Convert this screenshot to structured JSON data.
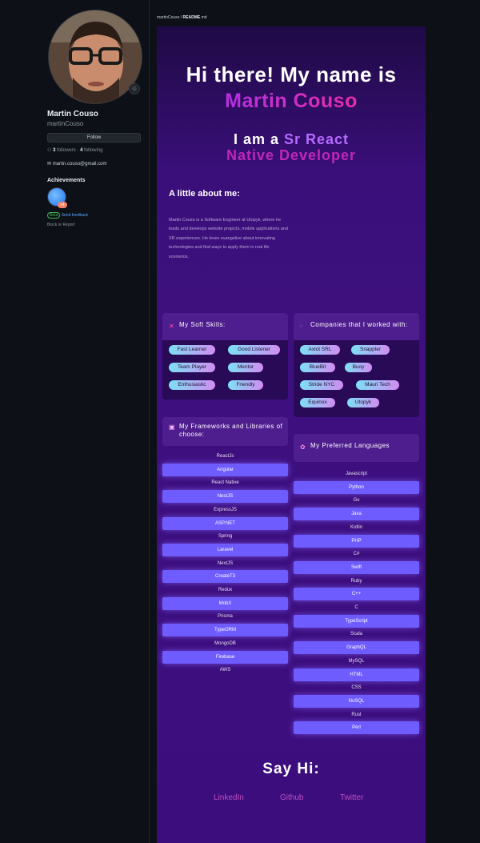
{
  "profile": {
    "name": "Martin Couso",
    "login": "martinCouso",
    "follow_label": "Follow",
    "followers_count": "3",
    "followers_label": "followers",
    "following_count": "4",
    "following_label": "following",
    "email": "martin.couso@gmail.com",
    "achievements_title": "Achievements",
    "achievement_count": "x4",
    "beta_tag": "Beta",
    "beta_link": "Send feedback",
    "block_report": "Block or Report"
  },
  "breadcrumb": {
    "repo": "martinCouso",
    "sep": "/",
    "file": "README",
    "ext": ".md"
  },
  "readme": {
    "hi": "Hi there! My name is",
    "name": "Martin Couso",
    "iam_prefix": "I am a",
    "iam_highlight": "Sr React",
    "role_line2": "Native Developer",
    "about_title": "A little about me:",
    "about_text": "Martin Couso is a Software Engineer at Utopyk, where he leads and develops website projects, mobile applications and XR experiences. He loves evangelize about innovating technologies and find ways to apply them in real life scenarios.",
    "soft_skills_title": "My Soft Skills:",
    "soft_skills": [
      "Fast Learner",
      "Good Listener",
      "Team Player",
      "Mentor",
      "Enthusiastic",
      "Friendly"
    ],
    "companies_title": "Companies that I worked with:",
    "companies": [
      "Axlot SRL",
      "Snappler",
      "BlueBit",
      "Buoy",
      "Stride NYC",
      "Mauri Tech",
      "Equinox",
      "Utopyk"
    ],
    "frameworks_title": "My Frameworks and Libraries of choose:",
    "frameworks": [
      "ReactJs",
      "Angular",
      "React Native",
      "NestJS",
      "ExpressJS",
      "ASP.NET",
      "Spring",
      "Laravel",
      "NextJS",
      "CreateT3",
      "Redux",
      "MobX",
      "Prisma",
      "TypeORM",
      "MongoDB",
      "Firebase",
      "AWS"
    ],
    "languages_title": "My Preferred Languages",
    "languages": [
      "Javascript",
      "Python",
      "Go",
      "Java",
      "Kotlin",
      "PHP",
      "C#",
      "Swift",
      "Ruby",
      "C++",
      "C",
      "TypeScript",
      "Scala",
      "GraphQL",
      "MySQL",
      "HTML",
      "CSS",
      "NoSQL",
      "Rust",
      "Perl"
    ],
    "say_hi": "Say Hi:",
    "social": [
      "LinkedIn",
      "Github",
      "Twitter"
    ]
  },
  "colors": {
    "accent_pill": "#6f5cff",
    "name_gradient": [
      "#9b30ff",
      "#ff2d8d"
    ],
    "chip_gradient": [
      "#7de0f5",
      "#d18cf2"
    ]
  }
}
